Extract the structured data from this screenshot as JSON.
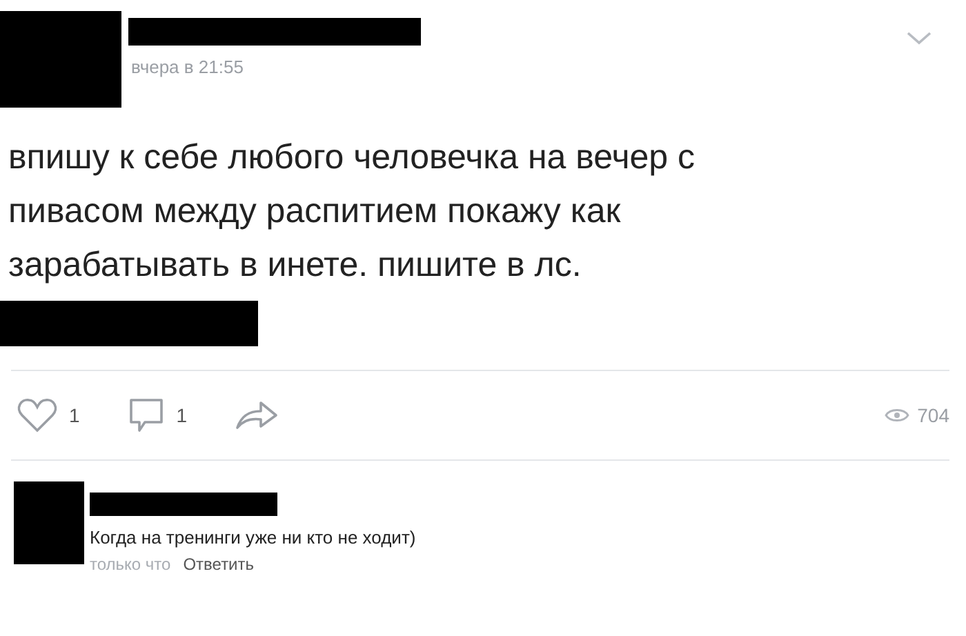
{
  "post": {
    "time": "вчера в 21:55",
    "text_lines": [
      "впишу к себе любого человечка на вечер с",
      "пивасом между распитием покажу как",
      "зарабатывать в инете. пишите в лс."
    ],
    "likes": "1",
    "comments": "1",
    "views": "704"
  },
  "comment": {
    "text": "Когда на тренинги уже ни кто не ходит)",
    "time": "только что",
    "reply": "Ответить"
  }
}
